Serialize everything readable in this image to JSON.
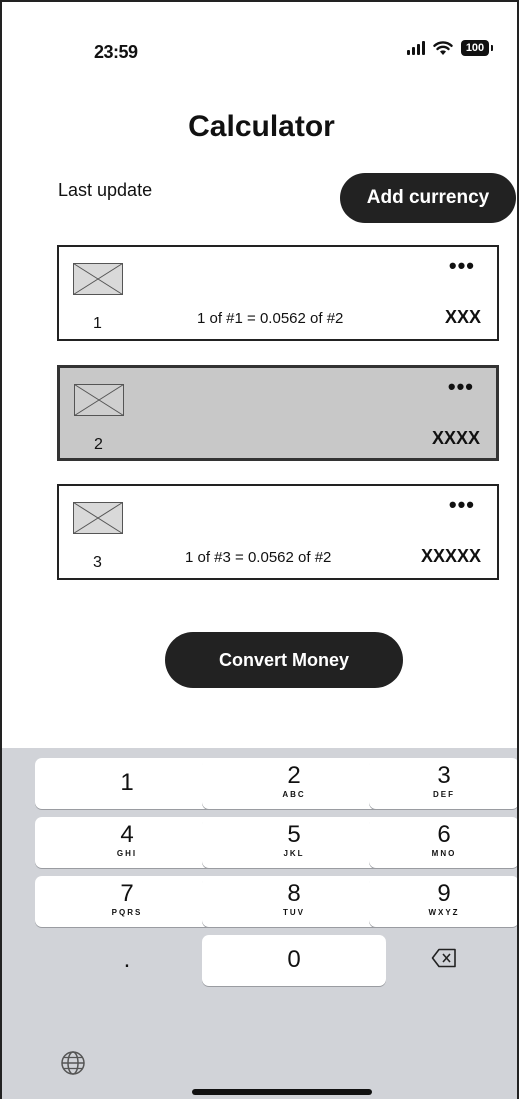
{
  "status_bar": {
    "time": "23:59",
    "battery": "100"
  },
  "header": {
    "title": "Calculator"
  },
  "last_update_label": "Last update",
  "add_currency_label": "Add currency",
  "cards": [
    {
      "index": "1",
      "rate": "1 of #1 = 0.0562 of #2",
      "more": "•••",
      "amount": "XXX",
      "selected": false
    },
    {
      "index": "2",
      "rate": "",
      "more": "•••",
      "amount": "XXXX",
      "selected": true
    },
    {
      "index": "3",
      "rate": "1 of #3 = 0.0562 of #2",
      "more": "•••",
      "amount": "XXXXX",
      "selected": false
    }
  ],
  "convert_label": "Convert Money",
  "keypad": {
    "keys": [
      {
        "digit": "1",
        "letters": ""
      },
      {
        "digit": "2",
        "letters": "ABC"
      },
      {
        "digit": "3",
        "letters": "DEF"
      },
      {
        "digit": "4",
        "letters": "GHI"
      },
      {
        "digit": "5",
        "letters": "JKL"
      },
      {
        "digit": "6",
        "letters": "MNO"
      },
      {
        "digit": "7",
        "letters": "PQRS"
      },
      {
        "digit": "8",
        "letters": "TUV"
      },
      {
        "digit": "9",
        "letters": "WXYZ"
      }
    ],
    "decimal": ".",
    "zero": "0",
    "icons": {
      "delete": "backspace-icon",
      "globe": "globe-icon"
    }
  }
}
